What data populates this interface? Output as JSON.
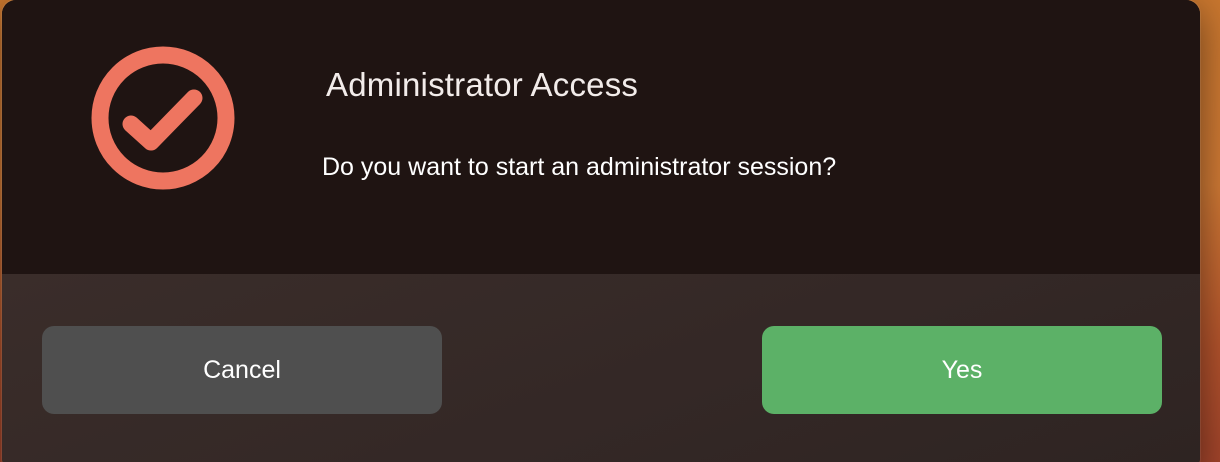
{
  "dialog": {
    "icon": "check-circle-icon",
    "icon_color": "#ee7560",
    "title": "Administrator Access",
    "message": "Do you want to start an administrator session?",
    "buttons": {
      "cancel_label": "Cancel",
      "yes_label": "Yes"
    },
    "colors": {
      "cancel_button": "#4f4f4f",
      "yes_button": "#5cb167",
      "background_top": "#1f1412",
      "background_bottom": "#352927"
    }
  }
}
